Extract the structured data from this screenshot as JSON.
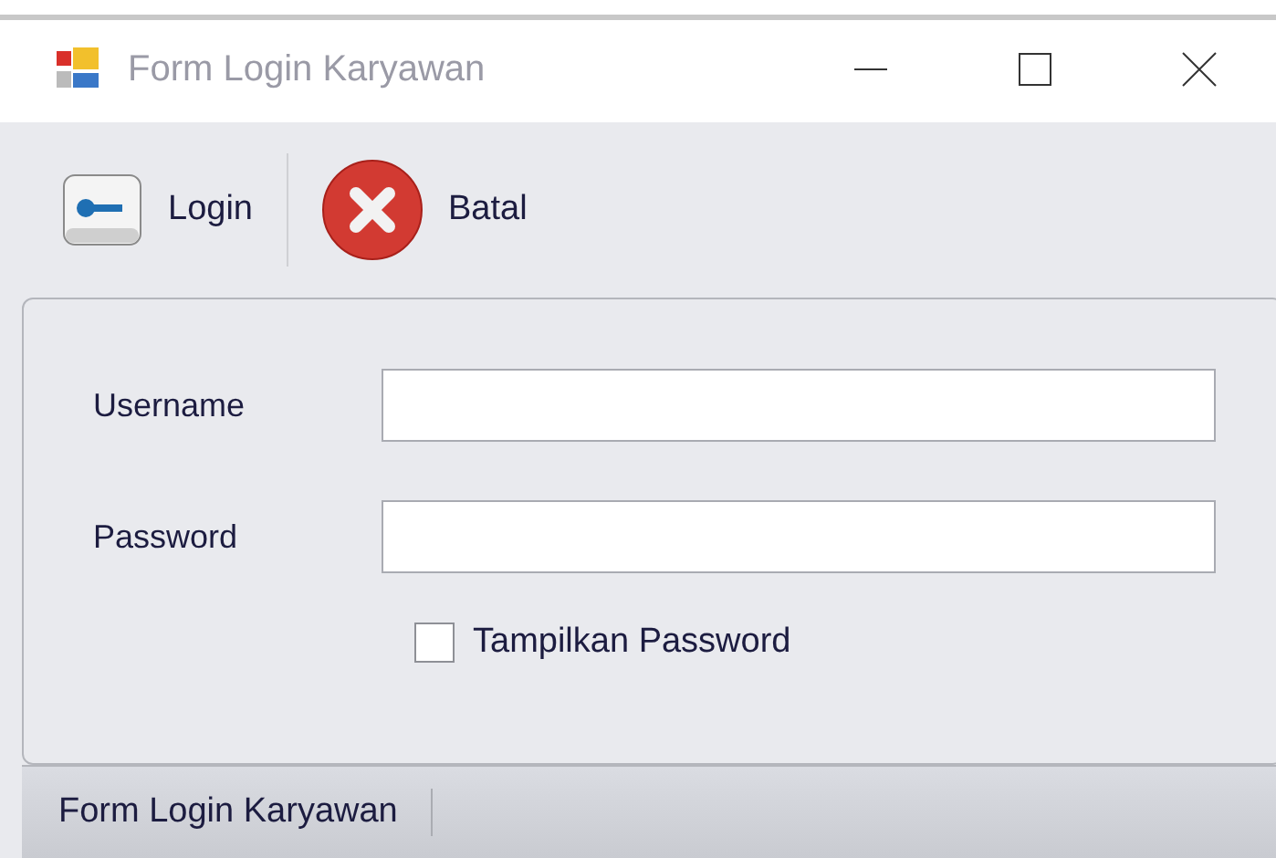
{
  "window": {
    "title": "Form Login Karyawan"
  },
  "toolbar": [
    {
      "kind": "login",
      "label": "Login"
    },
    {
      "kind": "cancel",
      "label": "Batal"
    }
  ],
  "form": {
    "fields": [
      {
        "label": "Username"
      },
      {
        "label": "Password"
      }
    ],
    "checkbox": {
      "label": "Tampilkan Password",
      "checked": false
    }
  },
  "status_bar": {
    "text": "Form Login Karyawan"
  }
}
